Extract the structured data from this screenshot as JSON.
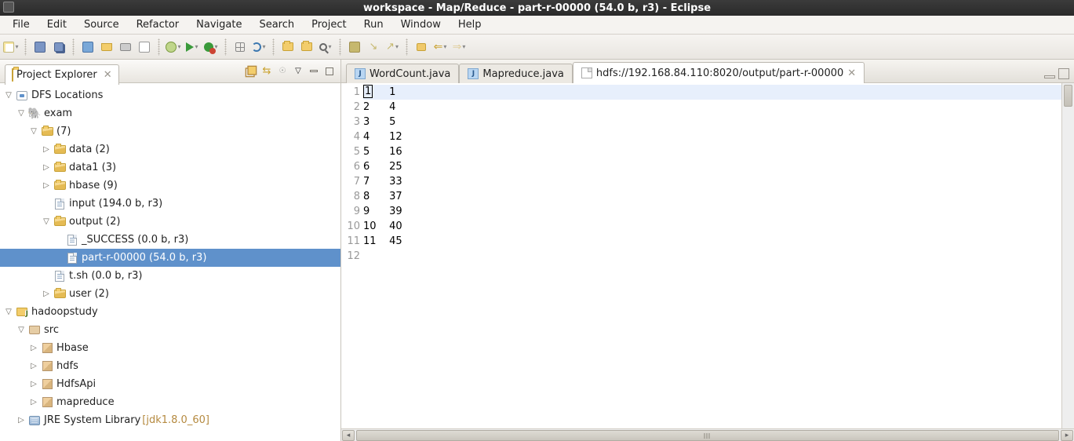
{
  "window": {
    "title": "workspace - Map/Reduce - part-r-00000 (54.0 b, r3) - Eclipse"
  },
  "menu": [
    "File",
    "Edit",
    "Source",
    "Refactor",
    "Navigate",
    "Search",
    "Project",
    "Run",
    "Window",
    "Help"
  ],
  "explorer": {
    "title": "Project Explorer",
    "tree": [
      {
        "d": 0,
        "tw": "open",
        "icon": "dfs",
        "text": "DFS Locations"
      },
      {
        "d": 1,
        "tw": "open",
        "icon": "eleph",
        "text": "exam"
      },
      {
        "d": 2,
        "tw": "open",
        "icon": "folder-open",
        "text": "(7)"
      },
      {
        "d": 3,
        "tw": "closed",
        "icon": "folder-open",
        "text": "data (2)"
      },
      {
        "d": 3,
        "tw": "closed",
        "icon": "folder-open",
        "text": "data1 (3)"
      },
      {
        "d": 3,
        "tw": "closed",
        "icon": "folder-open",
        "text": "hbase (9)"
      },
      {
        "d": 3,
        "tw": "none",
        "icon": "file",
        "text": "input (194.0 b, r3)"
      },
      {
        "d": 3,
        "tw": "open",
        "icon": "folder-open",
        "text": "output (2)"
      },
      {
        "d": 4,
        "tw": "none",
        "icon": "file",
        "text": "_SUCCESS (0.0 b, r3)"
      },
      {
        "d": 4,
        "tw": "none",
        "icon": "file",
        "text": "part-r-00000 (54.0 b, r3)",
        "selected": true
      },
      {
        "d": 3,
        "tw": "none",
        "icon": "file",
        "text": "t.sh (0.0 b, r3)"
      },
      {
        "d": 3,
        "tw": "closed",
        "icon": "folder-open",
        "text": "user (2)"
      },
      {
        "d": 0,
        "tw": "open",
        "icon": "prj",
        "text": "hadoopstudy"
      },
      {
        "d": 1,
        "tw": "open",
        "icon": "src",
        "text": "src"
      },
      {
        "d": 2,
        "tw": "closed",
        "icon": "pkg",
        "text": "Hbase"
      },
      {
        "d": 2,
        "tw": "closed",
        "icon": "pkg",
        "text": "hdfs"
      },
      {
        "d": 2,
        "tw": "closed",
        "icon": "pkg",
        "text": "HdfsApi"
      },
      {
        "d": 2,
        "tw": "closed",
        "icon": "pkg",
        "text": "mapreduce"
      },
      {
        "d": 1,
        "tw": "closed",
        "icon": "jre",
        "text": "JRE System Library",
        "decor": "[jdk1.8.0_60]"
      }
    ]
  },
  "editor": {
    "tabs": [
      {
        "kind": "java",
        "label": "WordCount.java"
      },
      {
        "kind": "java",
        "label": "Mapreduce.java"
      },
      {
        "kind": "file",
        "label": "hdfs://192.168.84.110:8020/output/part-r-00000",
        "active": true,
        "close": true
      }
    ],
    "content": [
      "1\t1",
      "2\t4",
      "3\t5",
      "4\t12",
      "5\t16",
      "6\t25",
      "7\t33",
      "8\t37",
      "9\t39",
      "10\t40",
      "11\t45",
      ""
    ]
  }
}
